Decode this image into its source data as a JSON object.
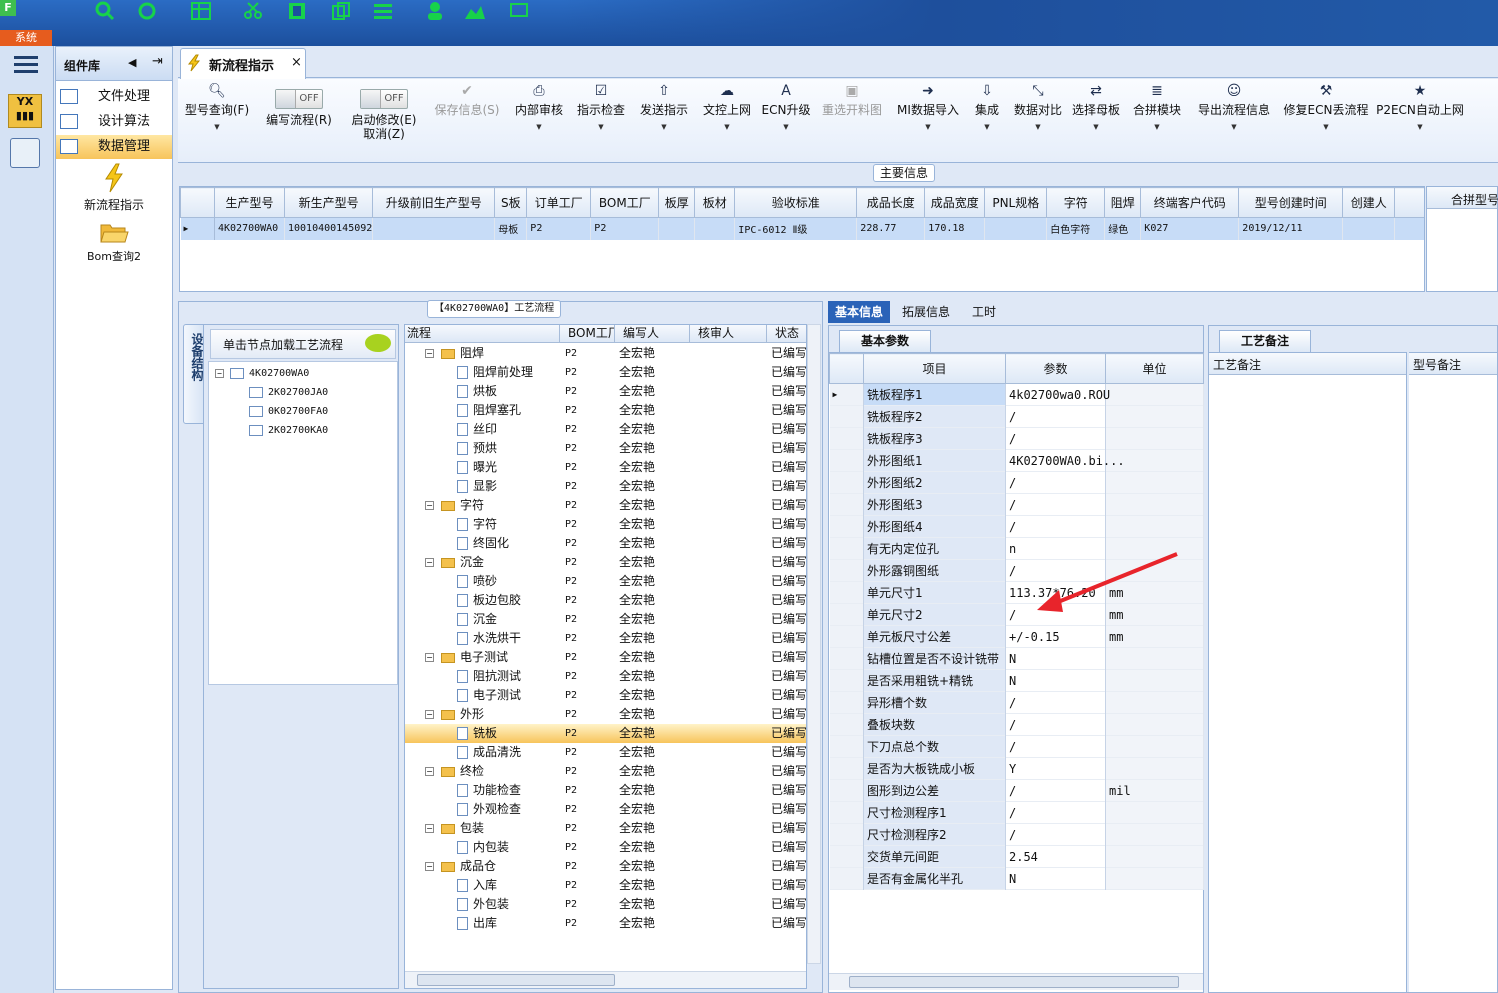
{
  "topbar": {
    "system_label": "系统"
  },
  "component_library": {
    "title": "组件库",
    "menu": [
      {
        "label": "文件处理",
        "selected": false
      },
      {
        "label": "设计算法",
        "selected": false
      },
      {
        "label": "数据管理",
        "selected": true
      }
    ],
    "tools": [
      {
        "label": "新流程指示",
        "icon": "lightning-icon"
      },
      {
        "label": "Bom查询2",
        "icon": "folder-open-icon"
      }
    ]
  },
  "tab": {
    "label": "新流程指示",
    "close": "×"
  },
  "ribbon": [
    {
      "label": "型号查询(F)",
      "icon": "search-icon",
      "enabled": true
    },
    {
      "label": "编写流程(R)",
      "toggle": "OFF",
      "enabled": true
    },
    {
      "label": "启动修改(E)",
      "label2": "取消(Z)",
      "toggle": "OFF",
      "enabled": true
    },
    {
      "label": "保存信息(S)",
      "icon": "check-icon",
      "enabled": false
    },
    {
      "label": "内部审核",
      "icon": "print-icon",
      "enabled": true
    },
    {
      "label": "指示检查",
      "icon": "checkbox-icon",
      "enabled": true
    },
    {
      "label": "发送指示",
      "icon": "upload-icon",
      "enabled": true
    },
    {
      "label": "文控上网",
      "icon": "cloud-upload-icon",
      "enabled": true
    },
    {
      "label": "ECN升级",
      "icon": "font-icon",
      "enabled": true
    },
    {
      "label": "重选开料图",
      "icon": "image-icon",
      "enabled": false
    },
    {
      "label": "MI数据导入",
      "icon": "sign-in-icon",
      "enabled": true
    },
    {
      "label": "集成",
      "icon": "download-icon",
      "enabled": true
    },
    {
      "label": "数据对比",
      "icon": "compress-icon",
      "enabled": true
    },
    {
      "label": "选择母板",
      "icon": "shuffle-icon",
      "enabled": true
    },
    {
      "label": "合拼模块",
      "icon": "list-icon",
      "enabled": true
    },
    {
      "label": "导出流程信息",
      "icon": "smile-icon",
      "enabled": true
    },
    {
      "label": "修复ECN丢流程",
      "icon": "wrench-icon",
      "enabled": true
    },
    {
      "label": "P2ECN自动上网",
      "icon": "star-icon",
      "enabled": true
    }
  ],
  "main_info": {
    "title": "主要信息",
    "columns": [
      "生产型号",
      "新生产型号",
      "升级前旧生产型号",
      "S板",
      "订单工厂",
      "BOM工厂",
      "板厚",
      "板材",
      "验收标准",
      "成品长度",
      "成品宽度",
      "PNL规格",
      "字符",
      "阻焊",
      "终端客户代码",
      "型号创建时间",
      "创建人"
    ],
    "row": [
      "4K02700WA0",
      "10010400145092",
      "",
      "母板",
      "P2",
      "P2",
      "",
      "",
      "IPC-6012 Ⅱ级",
      "228.77",
      "170.18",
      "",
      "白色字符",
      "绿色",
      "K027",
      "2019/12/11",
      ""
    ],
    "side_title": "合拼型号"
  },
  "flow": {
    "title": "【4K02700WA0】工艺流程",
    "hint": "单击节点加载工艺流程",
    "side_tab": "设备结构",
    "product_tree": {
      "root": "4K02700WA0",
      "children": [
        "2K02700JA0",
        "0K02700FA0",
        "2K02700KA0"
      ]
    },
    "columns": [
      "流程",
      "BOM工厂",
      "编写人",
      "核审人",
      "状态"
    ],
    "rows": [
      {
        "name": "阻焊",
        "level": 0,
        "factory": "P2",
        "author": "全宏艳",
        "status": "已编写"
      },
      {
        "name": "阻焊前处理",
        "level": 1,
        "factory": "P2",
        "author": "全宏艳",
        "status": "已编写"
      },
      {
        "name": "烘板",
        "level": 1,
        "factory": "P2",
        "author": "全宏艳",
        "status": "已编写"
      },
      {
        "name": "阻焊塞孔",
        "level": 1,
        "factory": "P2",
        "author": "全宏艳",
        "status": "已编写"
      },
      {
        "name": "丝印",
        "level": 1,
        "factory": "P2",
        "author": "全宏艳",
        "status": "已编写"
      },
      {
        "name": "预烘",
        "level": 1,
        "factory": "P2",
        "author": "全宏艳",
        "status": "已编写"
      },
      {
        "name": "曝光",
        "level": 1,
        "factory": "P2",
        "author": "全宏艳",
        "status": "已编写"
      },
      {
        "name": "显影",
        "level": 1,
        "factory": "P2",
        "author": "全宏艳",
        "status": "已编写"
      },
      {
        "name": "字符",
        "level": 0,
        "factory": "P2",
        "author": "全宏艳",
        "status": "已编写"
      },
      {
        "name": "字符",
        "level": 1,
        "factory": "P2",
        "author": "全宏艳",
        "status": "已编写"
      },
      {
        "name": "终固化",
        "level": 1,
        "factory": "P2",
        "author": "全宏艳",
        "status": "已编写"
      },
      {
        "name": "沉金",
        "level": 0,
        "factory": "P2",
        "author": "全宏艳",
        "status": "已编写"
      },
      {
        "name": "喷砂",
        "level": 1,
        "factory": "P2",
        "author": "全宏艳",
        "status": "已编写"
      },
      {
        "name": "板边包胶",
        "level": 1,
        "factory": "P2",
        "author": "全宏艳",
        "status": "已编写"
      },
      {
        "name": "沉金",
        "level": 1,
        "factory": "P2",
        "author": "全宏艳",
        "status": "已编写"
      },
      {
        "name": "水洗烘干",
        "level": 1,
        "factory": "P2",
        "author": "全宏艳",
        "status": "已编写"
      },
      {
        "name": "电子测试",
        "level": 0,
        "factory": "P2",
        "author": "全宏艳",
        "status": "已编写"
      },
      {
        "name": "阻抗测试",
        "level": 1,
        "factory": "P2",
        "author": "全宏艳",
        "status": "已编写"
      },
      {
        "name": "电子测试",
        "level": 1,
        "factory": "P2",
        "author": "全宏艳",
        "status": "已编写"
      },
      {
        "name": "外形",
        "level": 0,
        "factory": "P2",
        "author": "全宏艳",
        "status": "已编写"
      },
      {
        "name": "铣板",
        "level": 1,
        "factory": "P2",
        "author": "全宏艳",
        "status": "已编写",
        "selected": true
      },
      {
        "name": "成品清洗",
        "level": 1,
        "factory": "P2",
        "author": "全宏艳",
        "status": "已编写"
      },
      {
        "name": "终检",
        "level": 0,
        "factory": "P2",
        "author": "全宏艳",
        "status": "已编写"
      },
      {
        "name": "功能检查",
        "level": 1,
        "factory": "P2",
        "author": "全宏艳",
        "status": "已编写"
      },
      {
        "name": "外观检查",
        "level": 1,
        "factory": "P2",
        "author": "全宏艳",
        "status": "已编写"
      },
      {
        "name": "包装",
        "level": 0,
        "factory": "P2",
        "author": "全宏艳",
        "status": "已编写"
      },
      {
        "name": "内包装",
        "level": 1,
        "factory": "P2",
        "author": "全宏艳",
        "status": "已编写"
      },
      {
        "name": "成品仓",
        "level": 0,
        "factory": "P2",
        "author": "全宏艳",
        "status": "已编写"
      },
      {
        "name": "入库",
        "level": 1,
        "factory": "P2",
        "author": "全宏艳",
        "status": "已编写"
      },
      {
        "name": "外包装",
        "level": 1,
        "factory": "P2",
        "author": "全宏艳",
        "status": "已编写"
      },
      {
        "name": "出库",
        "level": 1,
        "factory": "P2",
        "author": "全宏艳",
        "status": "已编写"
      }
    ]
  },
  "detail": {
    "tabs": [
      {
        "label": "基本信息",
        "active": true
      },
      {
        "label": "拓展信息",
        "active": false
      },
      {
        "label": "工时",
        "active": false
      }
    ],
    "section": "基本参数",
    "columns": [
      "项目",
      "参数",
      "单位"
    ],
    "params": [
      {
        "item": "铣板程序1",
        "value": "4k02700wa0.ROU",
        "unit": ""
      },
      {
        "item": "铣板程序2",
        "value": "/",
        "unit": ""
      },
      {
        "item": "铣板程序3",
        "value": "/",
        "unit": ""
      },
      {
        "item": "外形图纸1",
        "value": "4K02700WA0.bi...",
        "unit": ""
      },
      {
        "item": "外形图纸2",
        "value": "/",
        "unit": ""
      },
      {
        "item": "外形图纸3",
        "value": "/",
        "unit": ""
      },
      {
        "item": "外形图纸4",
        "value": "/",
        "unit": ""
      },
      {
        "item": "有无内定位孔",
        "value": "n",
        "unit": ""
      },
      {
        "item": "外形露铜图纸",
        "value": "/",
        "unit": ""
      },
      {
        "item": "单元尺寸1",
        "value": "113.37*76.20",
        "unit": "mm"
      },
      {
        "item": "单元尺寸2",
        "value": "/",
        "unit": "mm"
      },
      {
        "item": "单元板尺寸公差",
        "value": "+/-0.15",
        "unit": "mm"
      },
      {
        "item": "钻槽位置是否不设计铣带",
        "value": "N",
        "unit": ""
      },
      {
        "item": "是否采用粗铣+精铣",
        "value": "N",
        "unit": ""
      },
      {
        "item": "异形槽个数",
        "value": "/",
        "unit": ""
      },
      {
        "item": "叠板块数",
        "value": "/",
        "unit": ""
      },
      {
        "item": "下刀点总个数",
        "value": "/",
        "unit": ""
      },
      {
        "item": "是否为大板铣成小板",
        "value": "Y",
        "unit": ""
      },
      {
        "item": "图形到边公差",
        "value": "/",
        "unit": "mil"
      },
      {
        "item": "尺寸检测程序1",
        "value": "/",
        "unit": ""
      },
      {
        "item": "尺寸检测程序2",
        "value": "/",
        "unit": ""
      },
      {
        "item": "交货单元间距",
        "value": "2.54",
        "unit": ""
      },
      {
        "item": "是否有金属化半孔",
        "value": "N",
        "unit": ""
      }
    ]
  },
  "remarks": {
    "tab": "工艺备注",
    "process_remark": "工艺备注",
    "model_remark": "型号备注"
  },
  "colors": {
    "accent": "#1c4f9d",
    "selected_row": "#c7dcf7",
    "highlight": "#f7c45b",
    "arrow": "#e8242b"
  }
}
